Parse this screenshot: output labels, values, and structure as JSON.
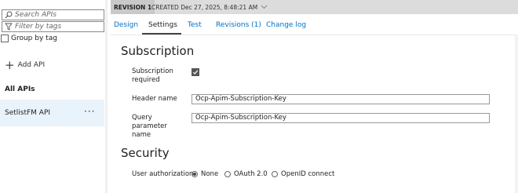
{
  "sidebar": {
    "search_placeholder": "Search APIs",
    "filter_placeholder": "Filter by tags",
    "group_by_tag_label": "Group by tag",
    "add_api_label": "Add API",
    "section_title": "All APIs",
    "apis": [
      {
        "name": "SetlistFM API",
        "selected": true,
        "more_icon": "ellipsis-icon"
      }
    ]
  },
  "revision_bar": {
    "badge": "REVISION 1",
    "created": "CREATED Dec 27, 2025, 8:48:21 AM",
    "dropdown_icon": "chevron-down-icon"
  },
  "tabs": [
    {
      "label": "Design",
      "active": false
    },
    {
      "label": "Settings",
      "active": true
    },
    {
      "label": "Test",
      "active": false
    },
    {
      "label": "Revisions (1)",
      "active": false
    },
    {
      "label": "Change log",
      "active": false
    }
  ],
  "subscription": {
    "heading": "Subscription",
    "required_label": "Subscription required",
    "required_checked": true,
    "header_name_label": "Header name",
    "header_name_value": "Ocp-Apim-Subscription-Key",
    "query_param_label": "Query parameter name",
    "query_param_value": "Ocp-Apim-Subscription-Key"
  },
  "security": {
    "heading": "Security",
    "user_auth_label": "User authorization",
    "options": [
      {
        "label": "None",
        "selected": true
      },
      {
        "label": "OAuth 2.0",
        "selected": false
      },
      {
        "label": "OpenID connect",
        "selected": false
      }
    ]
  },
  "colors": {
    "link": "#0072c6",
    "selected_row": "#e9f3fb",
    "revision_bar": "#dcdcdc"
  }
}
